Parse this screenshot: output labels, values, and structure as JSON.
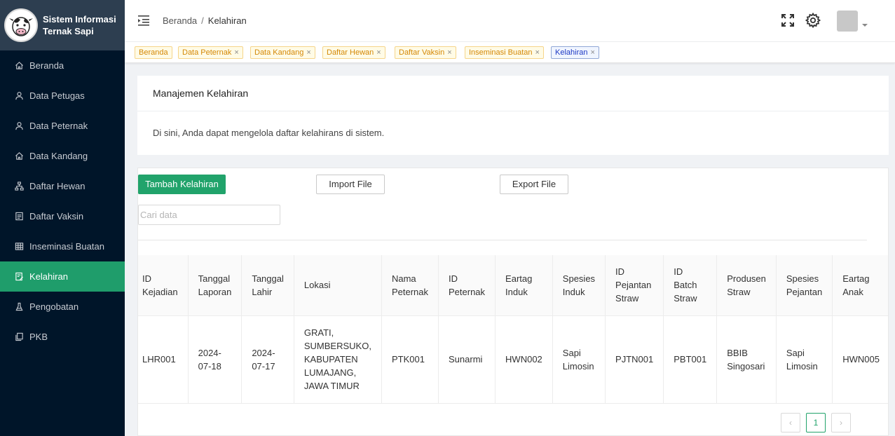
{
  "brand": {
    "title_line1": "Sistem Informasi",
    "title_line2": "Ternak Sapi"
  },
  "sidebar": {
    "items": [
      {
        "label": "Beranda",
        "icon": "home-icon"
      },
      {
        "label": "Data Petugas",
        "icon": "user-icon"
      },
      {
        "label": "Data Peternak",
        "icon": "user-icon"
      },
      {
        "label": "Data Kandang",
        "icon": "home-icon"
      },
      {
        "label": "Daftar Hewan",
        "icon": "sitemap-icon"
      },
      {
        "label": "Daftar Vaksin",
        "icon": "file-icon"
      },
      {
        "label": "Inseminasi Buatan",
        "icon": "table-icon"
      },
      {
        "label": "Kelahiran",
        "icon": "form-icon",
        "active": true
      },
      {
        "label": "Pengobatan",
        "icon": "experiment-icon"
      },
      {
        "label": "PKB",
        "icon": "copy-icon"
      }
    ]
  },
  "header": {
    "breadcrumb": {
      "home": "Beranda",
      "separator": "/",
      "current": "Kelahiran"
    }
  },
  "tags": [
    {
      "label": "Beranda",
      "closable": false
    },
    {
      "label": "Data Peternak",
      "closable": true
    },
    {
      "label": "Data Kandang",
      "closable": true
    },
    {
      "label": "Daftar Hewan",
      "closable": true
    },
    {
      "label": "Daftar Vaksin",
      "closable": true
    },
    {
      "label": "Inseminasi Buatan",
      "closable": true
    },
    {
      "label": "Kelahiran",
      "closable": true,
      "active": true
    }
  ],
  "tag_close_glyph": "×",
  "info": {
    "title": "Manajemen Kelahiran",
    "description": "Di sini, Anda dapat mengelola daftar kelahirans di sistem."
  },
  "toolbar": {
    "add_label": "Tambah Kelahiran",
    "import_label": "Import File",
    "export_label": "Export File",
    "search_placeholder": "Cari data"
  },
  "table": {
    "headers": [
      [
        "ID",
        "Kejadian"
      ],
      [
        "Tanggal",
        "Laporan"
      ],
      [
        "Tanggal",
        "Lahir"
      ],
      [
        "Lokasi"
      ],
      [
        "Nama",
        "Peternak"
      ],
      [
        "ID",
        "Peternak"
      ],
      [
        "Eartag",
        "Induk"
      ],
      [
        "Spesies",
        "Induk"
      ],
      [
        "ID",
        "Pejantan",
        "Straw"
      ],
      [
        "ID",
        "Batch",
        "Straw"
      ],
      [
        "Produsen",
        "Straw"
      ],
      [
        "Spesies",
        "Pejantan"
      ],
      [
        "Eartag",
        "Anak"
      ]
    ],
    "rows": [
      [
        [
          "LHR001"
        ],
        [
          "2024-",
          "07-18"
        ],
        [
          "2024-",
          "07-17"
        ],
        [
          "GRATI,",
          "SUMBERSUKO,",
          "KABUPATEN",
          "LUMAJANG,",
          "JAWA TIMUR"
        ],
        [
          "PTK001"
        ],
        [
          "Sunarmi"
        ],
        [
          "HWN002"
        ],
        [
          "Sapi",
          "Limosin"
        ],
        [
          "PJTN001"
        ],
        [
          "PBT001"
        ],
        [
          "BBIB",
          "Singosari"
        ],
        [
          "Sapi",
          "Limosin"
        ],
        [
          "HWN005"
        ]
      ]
    ]
  },
  "pagination": {
    "prev": "‹",
    "current": "1",
    "next": "›"
  },
  "colors": {
    "sidebar_bg": "#001529",
    "accent": "#21a36b",
    "tag_yellow": "#d48806",
    "tag_active": "#1d39c4"
  }
}
